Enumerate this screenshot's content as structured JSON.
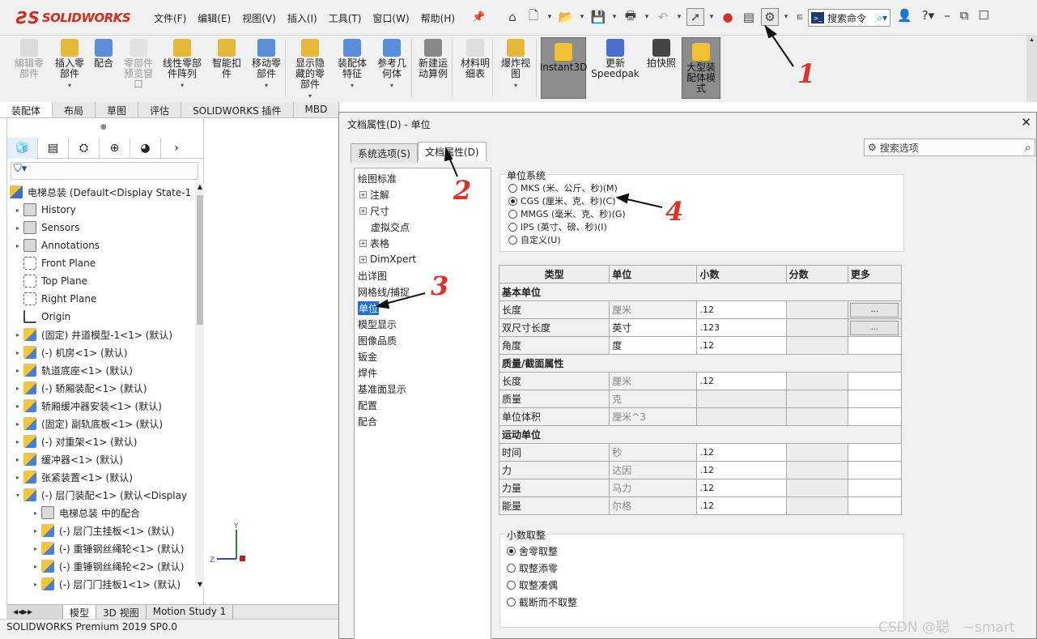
{
  "app": {
    "logo": "SOLIDWORKS",
    "menu": [
      "文件(F)",
      "编辑(E)",
      "视图(V)",
      "插入(I)",
      "工具(T)",
      "窗口(W)",
      "帮助(H)"
    ],
    "search_placeholder": "搜索命令"
  },
  "ribbon": {
    "items": [
      {
        "label": "编辑零\n部件",
        "disabled": true
      },
      {
        "label": "插入零\n部件",
        "disabled": false
      },
      {
        "label": "配合",
        "disabled": false
      },
      {
        "label": "零部件\n预览窗\n口",
        "disabled": true
      },
      {
        "label": "线性零部\n件阵列",
        "disabled": false
      },
      {
        "label": "智能扣\n件",
        "disabled": false
      },
      {
        "label": "移动零\n部件",
        "disabled": false
      },
      {
        "label": "显示隐\n藏的零\n部件",
        "disabled": false
      },
      {
        "label": "装配体\n特征",
        "disabled": false
      },
      {
        "label": "参考几\n何体",
        "disabled": false
      },
      {
        "label": "新建运\n动算例",
        "disabled": false
      },
      {
        "label": "材料明\n细表",
        "disabled": false
      },
      {
        "label": "爆炸视\n图",
        "disabled": false
      },
      {
        "label": "Instant3D",
        "disabled": false
      },
      {
        "label": "更新\nSpeedpak",
        "disabled": false
      },
      {
        "label": "拍快照",
        "disabled": false
      },
      {
        "label": "大型装\n配体模\n式",
        "disabled": false
      }
    ]
  },
  "cmd_tabs": [
    "装配体",
    "布局",
    "草图",
    "评估",
    "SOLIDWORKS 插件",
    "MBD"
  ],
  "feature_tree": {
    "root": "电梯总装  (Default<Display State-1",
    "items": [
      {
        "label": "History",
        "icon": "folder"
      },
      {
        "label": "Sensors",
        "icon": "folder"
      },
      {
        "label": "Annotations",
        "icon": "folder"
      },
      {
        "label": "Front Plane",
        "icon": "plane"
      },
      {
        "label": "Top Plane",
        "icon": "plane"
      },
      {
        "label": "Right Plane",
        "icon": "plane"
      },
      {
        "label": "Origin",
        "icon": "origin"
      },
      {
        "label": "(固定) 井道模型-1<1> (默认)",
        "icon": "part"
      },
      {
        "label": "(-) 机房<1> (默认)",
        "icon": "part"
      },
      {
        "label": "轨道底座<1> (默认)",
        "icon": "part"
      },
      {
        "label": "(-) 轿厢装配<1> (默认)",
        "icon": "part"
      },
      {
        "label": "轿厢缓冲器安装<1> (默认)",
        "icon": "part"
      },
      {
        "label": "(固定) 副轨底板<1> (默认)",
        "icon": "part"
      },
      {
        "label": "(-) 对重架<1> (默认)",
        "icon": "part"
      },
      {
        "label": "缓冲器<1> (默认)",
        "icon": "part"
      },
      {
        "label": "张紧装置<1> (默认)",
        "icon": "part"
      },
      {
        "label": "(-) 层门装配<1> (默认<Display",
        "icon": "part"
      },
      {
        "label": "电梯总装 中的配合",
        "icon": "folder"
      },
      {
        "label": "(-) 层门主挂板<1> (默认)",
        "icon": "part"
      },
      {
        "label": "(-) 重锤钢丝绳轮<1> (默认)",
        "icon": "part"
      },
      {
        "label": "(-) 重锤钢丝绳轮<2> (默认)",
        "icon": "part"
      },
      {
        "label": "(-) 层门门挂板1<1> (默认)",
        "icon": "part"
      }
    ]
  },
  "bottom_tabs": [
    "模型",
    "3D 视图",
    "Motion Study 1"
  ],
  "status": "SOLIDWORKS Premium 2019 SP0.0",
  "dialog": {
    "title": "文档属性(D) - 单位",
    "tabs": [
      "系统选项(S)",
      "文档属性(D)"
    ],
    "search_placeholder": "搜索选项",
    "nav": [
      {
        "label": "绘图标准",
        "level": 0
      },
      {
        "label": "注解",
        "level": 1,
        "plus": true
      },
      {
        "label": "尺寸",
        "level": 1,
        "plus": true
      },
      {
        "label": "虚拟交点",
        "level": 1
      },
      {
        "label": "表格",
        "level": 1,
        "plus": true
      },
      {
        "label": "DimXpert",
        "level": 1,
        "plus": true
      },
      {
        "label": "出详图",
        "level": 0
      },
      {
        "label": "网格线/捕捉",
        "level": 0
      },
      {
        "label": "单位",
        "level": 0,
        "selected": true
      },
      {
        "label": "模型显示",
        "level": 0
      },
      {
        "label": "图像品质",
        "level": 0
      },
      {
        "label": "钣金",
        "level": 0
      },
      {
        "label": "焊件",
        "level": 0
      },
      {
        "label": "基准面显示",
        "level": 0
      },
      {
        "label": "配置",
        "level": 0
      },
      {
        "label": "配合",
        "level": 0
      }
    ],
    "unit_system": {
      "legend": "单位系统",
      "options": [
        {
          "label": "MKS (米、公斤、秒)(M)",
          "checked": false
        },
        {
          "label": "CGS (厘米、克、秒)(C)",
          "checked": true
        },
        {
          "label": "MMGS (毫米、克、秒)(G)",
          "checked": false
        },
        {
          "label": "IPS (英寸、磅、秒)(I)",
          "checked": false
        },
        {
          "label": "自定义(U)",
          "checked": false
        }
      ]
    },
    "table": {
      "headers": [
        "类型",
        "单位",
        "小数",
        "分数",
        "更多"
      ],
      "groups": [
        {
          "name": "基本单位",
          "rows": [
            {
              "type": "长度",
              "unit": "厘米",
              "decimal": ".12",
              "unit_grey": true,
              "more": "..."
            },
            {
              "type": "双尺寸长度",
              "unit": "英寸",
              "decimal": ".123",
              "unit_grey": false,
              "more": "..."
            },
            {
              "type": "角度",
              "unit": "度",
              "decimal": ".12",
              "unit_grey": false,
              "more": ""
            }
          ]
        },
        {
          "name": "质量/截面属性",
          "rows": [
            {
              "type": "长度",
              "unit": "厘米",
              "decimal": ".12",
              "unit_grey": true,
              "more": ""
            },
            {
              "type": "质量",
              "unit": "克",
              "decimal": "",
              "unit_grey": true,
              "more": ""
            },
            {
              "type": "单位体积",
              "unit": "厘米^3",
              "decimal": "",
              "unit_grey": true,
              "more": ""
            }
          ]
        },
        {
          "name": "运动单位",
          "rows": [
            {
              "type": "时间",
              "unit": "秒",
              "decimal": ".12",
              "unit_grey": true,
              "more": ""
            },
            {
              "type": "力",
              "unit": "达因",
              "decimal": ".12",
              "unit_grey": true,
              "more": ""
            },
            {
              "type": "力量",
              "unit": "马力",
              "decimal": ".12",
              "unit_grey": true,
              "more": ""
            },
            {
              "type": "能量",
              "unit": "尔格",
              "decimal": ".12",
              "unit_grey": true,
              "more": ""
            }
          ]
        }
      ]
    },
    "rounding": {
      "legend": "小数取整",
      "options": [
        {
          "label": "舍零取整",
          "checked": true
        },
        {
          "label": "取整添零",
          "checked": false
        },
        {
          "label": "取整凑偶",
          "checked": false
        },
        {
          "label": "截断而不取整",
          "checked": false
        }
      ]
    }
  },
  "annotations": [
    "1",
    "2",
    "3",
    "4"
  ],
  "watermark": "CSDN @聪　~smart",
  "colors": {
    "brand": "#d52b1e",
    "annotation": "#e0302a",
    "selection": "#2a6bd1"
  }
}
